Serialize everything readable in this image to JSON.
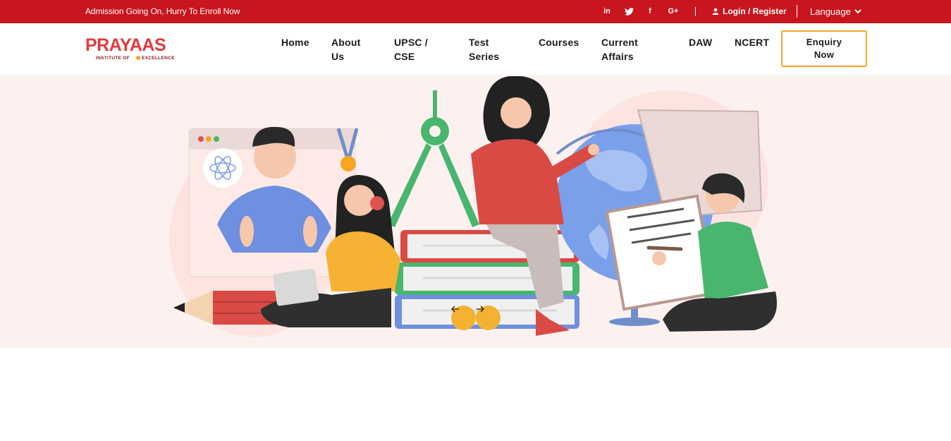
{
  "topbar": {
    "announcement": "Admission Going On, Hurry To Enroll Now",
    "social_icons": [
      "linkedin-icon",
      "twitter-icon",
      "facebook-icon",
      "google-plus-icon"
    ],
    "login_label": "Login / Register",
    "language_label": "Language"
  },
  "header": {
    "logo_text": "PRAYAAS",
    "logo_tagline": "INSTITUTE OF EXCELLENCE",
    "nav": {
      "home": "Home",
      "about_1": "About",
      "about_2": "Us",
      "upsc_1": "UPSC /",
      "upsc_2": "CSE",
      "test_1": "Test",
      "test_2": "Series",
      "courses": "Courses",
      "current_1": "Current",
      "current_2": "Affairs",
      "daw": "DAW",
      "ncert": "NCERT"
    },
    "enquiry_1": "Enquiry",
    "enquiry_2": "Now"
  },
  "colors": {
    "brand_red": "#c8151e",
    "accent_orange": "#f5a623",
    "hero_bg": "#fdf1f0"
  },
  "hero": {
    "prev_icon": "arrow-left-icon",
    "next_icon": "arrow-right-icon"
  }
}
